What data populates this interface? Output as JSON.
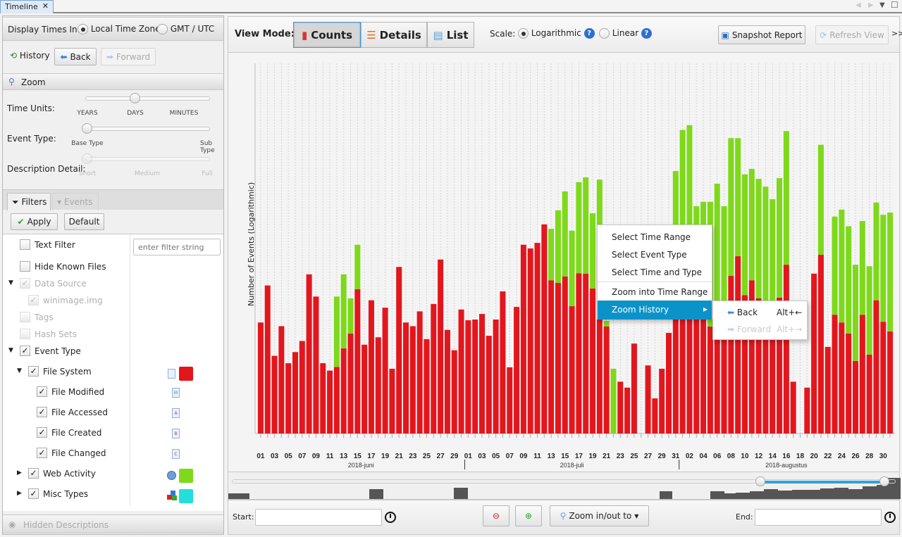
{
  "tab": {
    "title": "Timeline",
    "close": "✕"
  },
  "window_controls": {
    "prev": "◀",
    "next": "▶",
    "menu": "▼",
    "maximize": "☐"
  },
  "left": {
    "display_times_label": "Display Times In:",
    "tz_local": "Local Time Zone",
    "tz_gmt": "GMT / UTC",
    "tz_selected": "Local Time Zone",
    "history_label": "History",
    "back": "Back",
    "forward": "Forward",
    "zoom_header": "Zoom",
    "time_units_label": "Time Units:",
    "time_units_ticks": [
      "YEARS",
      "DAYS",
      "MINUTES"
    ],
    "time_units_value": "DAYS",
    "event_type_label": "Event Type:",
    "event_type_ticks": [
      "Base Type",
      "Sub Type"
    ],
    "event_type_value": "Base Type",
    "description_label": "Description Detail:",
    "description_ticks": [
      "Short",
      "Medium",
      "Full"
    ],
    "description_value": "Short",
    "tabs": {
      "filters": "Filters",
      "events": "Events"
    },
    "apply": "Apply",
    "default": "Default",
    "filter_placeholder": "enter filter string",
    "filters": {
      "text_filter": "Text Filter",
      "hide_known": "Hide Known Files",
      "data_source": "Data Source",
      "winimage": "winimage.img",
      "tags": "Tags",
      "hash_sets": "Hash Sets",
      "event_type": "Event Type",
      "file_system": "File System",
      "file_modified": "File Modified",
      "file_accessed": "File Accessed",
      "file_created": "File Created",
      "file_changed": "File Changed",
      "web_activity": "Web Activity",
      "misc_types": "Misc Types"
    },
    "file_icon_letters": {
      "m": "M",
      "a": "A",
      "b": "B",
      "c": "C"
    },
    "colors": {
      "file_system": "#e3161d",
      "web_activity": "#7ed91a",
      "misc_types": "#22dede"
    },
    "hidden_descriptions": "Hidden Descriptions"
  },
  "toolbar": {
    "view_mode_label": "View Mode:",
    "counts": "Counts",
    "details": "Details",
    "list": "List",
    "selected_mode": "Counts",
    "scale_label": "Scale:",
    "logarithmic": "Logarithmic",
    "linear": "Linear",
    "help": "?",
    "snapshot": "Snapshot Report",
    "refresh": "Refresh View",
    "overflow": ">>"
  },
  "context_menu": {
    "items": [
      "Select Time Range",
      "Select Event Type",
      "Select Time and Type",
      "Zoom into Time Range",
      "Zoom History"
    ],
    "submenu_arrow": "▸",
    "submenu": [
      {
        "label": "Back",
        "shortcut": "Alt+←"
      },
      {
        "label": "Forward",
        "shortcut": "Alt+→"
      }
    ]
  },
  "bottom": {
    "start_label": "Start:",
    "start_value": "",
    "end_label": "End:",
    "end_value": "",
    "zoom_to": "Zoom in/out to"
  },
  "chart_data": {
    "type": "bar",
    "stacked": true,
    "title": "",
    "ylabel": "Number of Events (Logarithmic)",
    "yscale": "log",
    "value_units": "percent of axis height (no y tick labels shown)",
    "months": [
      {
        "label": "2018-juni",
        "days": 30
      },
      {
        "label": "2018-juli",
        "days": 31
      },
      {
        "label": "2018-augustus",
        "days": 31
      }
    ],
    "x_tick_labels": [
      "01",
      "03",
      "05",
      "07",
      "09",
      "11",
      "13",
      "15",
      "17",
      "19",
      "21",
      "23",
      "25",
      "27",
      "29",
      "01",
      "03",
      "05",
      "07",
      "09",
      "11",
      "13",
      "15",
      "17",
      "19",
      "21",
      "23",
      "25",
      "27",
      "29",
      "31",
      "02",
      "04",
      "06",
      "08",
      "10",
      "12",
      "14",
      "16",
      "18",
      "20",
      "22",
      "24",
      "26",
      "28",
      "30"
    ],
    "series": [
      {
        "name": "File System",
        "color": "#e3161d",
        "values": [
          30,
          40,
          21,
          29,
          19,
          22,
          25,
          43,
          37,
          19,
          17,
          18,
          23,
          27,
          39,
          24,
          36,
          26,
          34,
          17.5,
          45,
          30,
          29,
          33,
          25.5,
          35,
          47,
          28,
          22.5,
          33.5,
          30.6,
          30.8,
          32.3,
          26.4,
          30.8,
          38.4,
          17.9,
          34.2,
          51,
          50,
          51.5,
          56.5,
          41.4,
          40.7,
          42.4,
          34.4,
          43.3,
          43.2,
          39.2,
          47.9,
          28.9,
          0,
          14,
          12.4,
          24.3,
          0,
          18.4,
          9.5,
          17.5,
          27.2,
          32,
          32,
          32,
          32,
          32,
          28.9,
          32,
          32,
          42.6,
          47.9,
          37.4,
          41.4,
          36.5,
          35,
          35,
          36.7,
          45.6,
          14,
          0,
          12.4,
          43.2,
          48.3,
          23.4,
          32.1,
          30,
          27,
          19.6,
          32.1,
          21.3,
          36,
          30.2,
          27.6
        ]
      },
      {
        "name": "Web Activity",
        "color": "#7ed91a",
        "values": [
          0,
          0,
          0,
          0,
          0,
          0,
          0,
          0,
          0,
          0,
          0,
          19,
          20,
          9.5,
          12,
          0,
          0,
          0,
          0,
          0,
          0,
          0,
          0,
          0,
          0,
          0,
          0,
          0,
          0,
          0,
          0,
          0,
          0,
          0,
          0,
          0,
          0,
          0,
          0,
          0,
          0,
          0,
          13.9,
          19.6,
          23,
          20.4,
          24.6,
          26,
          20.3,
          20.7,
          1.5,
          17.5,
          0,
          0,
          0,
          0,
          0,
          0,
          0,
          0,
          38.9,
          50,
          51.3,
          29.4,
          30.6,
          33.7,
          35.5,
          29.4,
          37.2,
          31.9,
          32.6,
          30.1,
          32.3,
          31.7,
          28.3,
          32.3,
          36.1,
          0,
          0,
          0,
          0,
          29.7,
          0,
          26.5,
          30.5,
          29,
          26,
          25.3,
          23.9,
          26.4,
          28.9,
          32.1
        ]
      }
    ]
  }
}
